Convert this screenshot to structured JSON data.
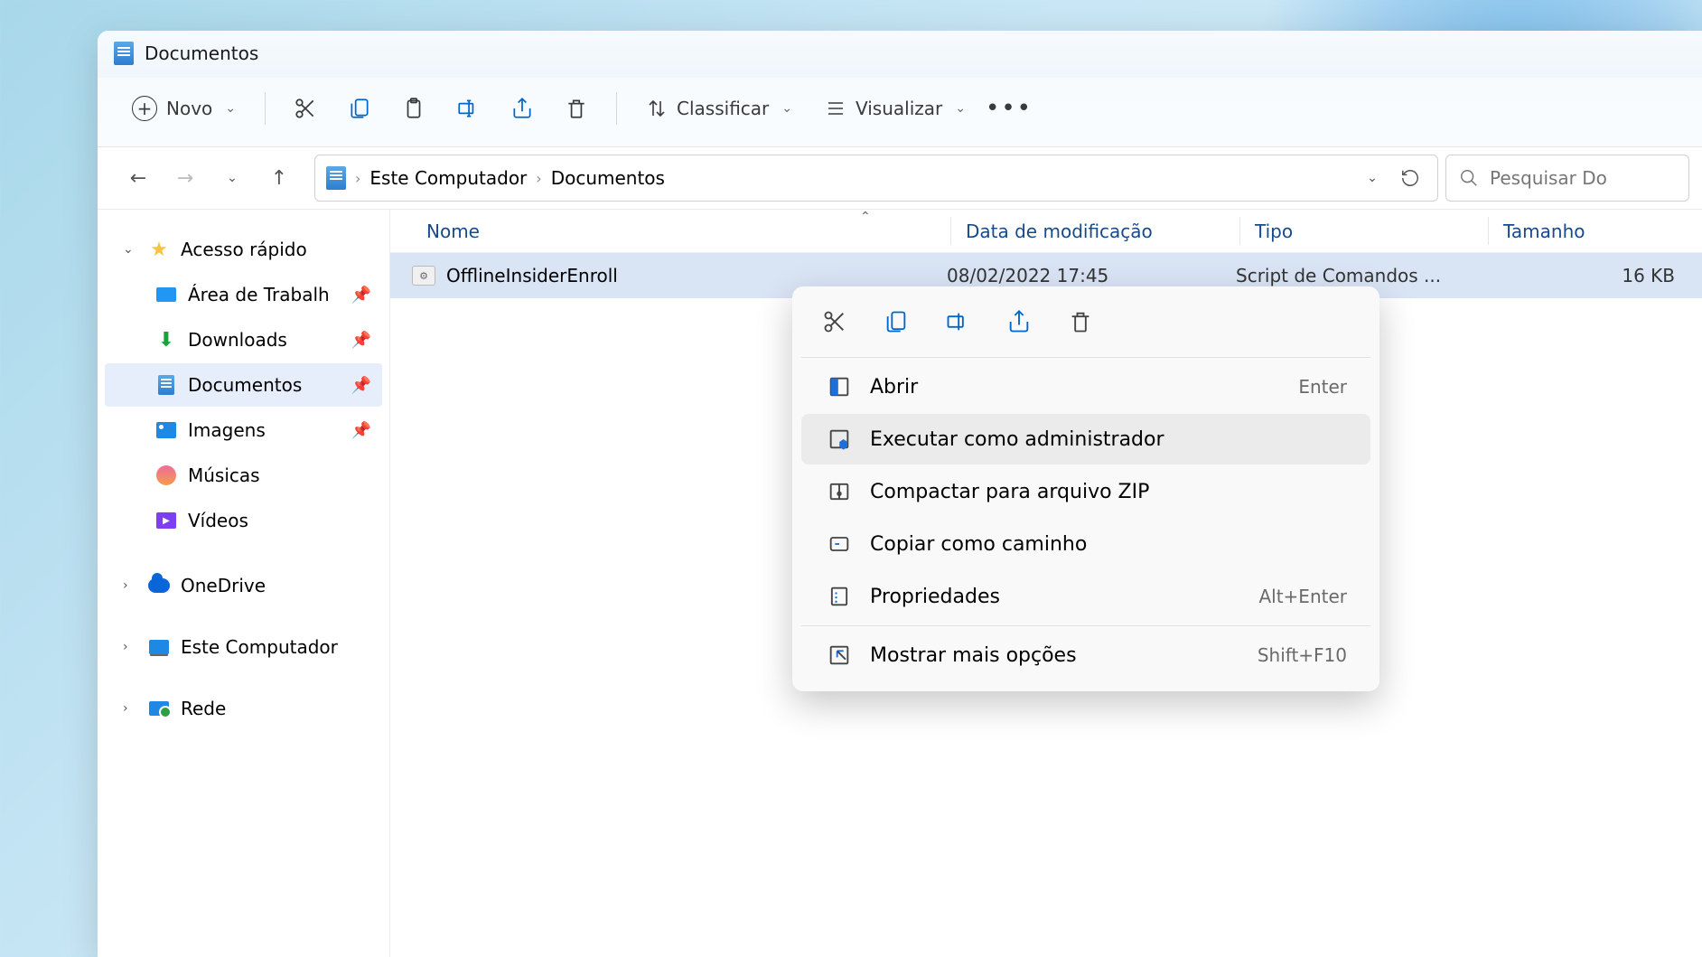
{
  "titlebar": {
    "title": "Documentos"
  },
  "toolbar": {
    "new_label": "Novo",
    "sort_label": "Classificar",
    "view_label": "Visualizar"
  },
  "breadcrumb": {
    "root": "Este Computador",
    "current": "Documentos"
  },
  "search": {
    "placeholder": "Pesquisar Do"
  },
  "sidebar": {
    "quick_access": "Acesso rápido",
    "desktop": "Área de Trabalh",
    "downloads": "Downloads",
    "documents": "Documentos",
    "pictures": "Imagens",
    "music": "Músicas",
    "videos": "Vídeos",
    "onedrive": "OneDrive",
    "this_pc": "Este Computador",
    "network": "Rede"
  },
  "columns": {
    "name": "Nome",
    "modified": "Data de modificação",
    "type": "Tipo",
    "size": "Tamanho"
  },
  "file": {
    "name": "OfflineInsiderEnroll",
    "modified": "08/02/2022 17:45",
    "type": "Script de Comandos ...",
    "size": "16 KB"
  },
  "context_menu": {
    "open": "Abrir",
    "open_kb": "Enter",
    "run_admin": "Executar como administrador",
    "compress": "Compactar para arquivo ZIP",
    "copy_path": "Copiar como caminho",
    "properties": "Propriedades",
    "properties_kb": "Alt+Enter",
    "more": "Mostrar mais opções",
    "more_kb": "Shift+F10"
  }
}
